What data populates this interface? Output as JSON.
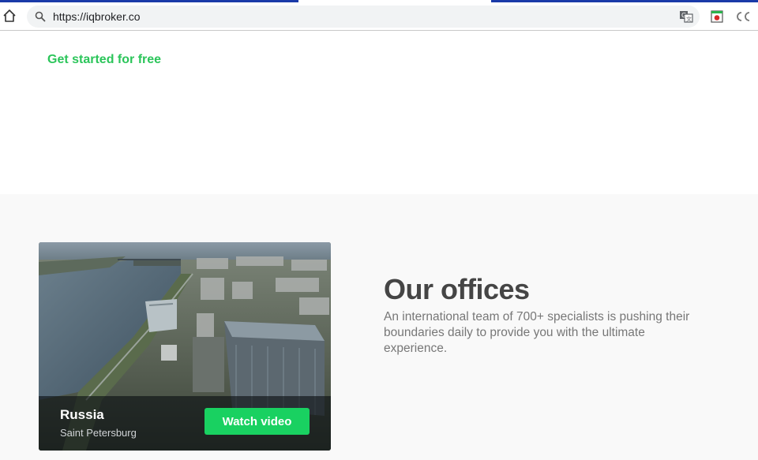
{
  "browser": {
    "url": "https://iqbroker.co",
    "icons": [
      "home-icon",
      "search-icon",
      "translate-icon",
      "extension-icon",
      "cc-extension-icon"
    ],
    "accent_color": "#1a3aa8"
  },
  "page": {
    "cta_link": "Get started for free",
    "cta_color": "#2bc55a"
  },
  "offices": {
    "title": "Our offices",
    "description": "An international team of 700+ specialists is pushing their boundaries daily to provide you with the ultimate experience.",
    "card": {
      "city": "Russia",
      "subtitle": "Saint Petersburg",
      "button_label": "Watch video",
      "button_color": "#19d161"
    }
  }
}
